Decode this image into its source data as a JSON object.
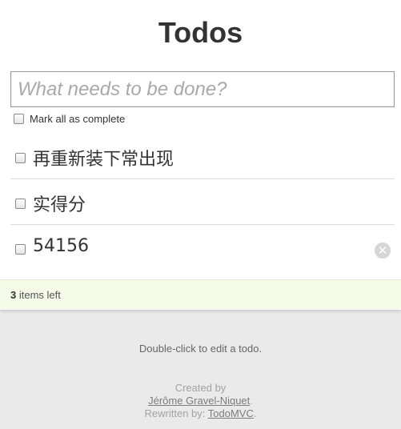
{
  "header": {
    "title": "Todos"
  },
  "new_todo": {
    "placeholder": "What needs to be done?"
  },
  "toggle_all": {
    "label": "Mark all as complete"
  },
  "todos": [
    {
      "text": "再重新装下常出现",
      "completed": false
    },
    {
      "text": "实得分",
      "completed": false
    },
    {
      "text": "54156",
      "completed": false
    }
  ],
  "destroy_icon": "close-icon",
  "footer": {
    "count": "3",
    "count_suffix": " items left"
  },
  "info": {
    "instructions": "Double-click to edit a todo.",
    "created_by": "Created by",
    "author_link": "Jérôme Gravel-Niquet",
    "author_period": ".",
    "rewritten_by": "Rewritten by: ",
    "rewriter_link": "TodoMVC",
    "rewriter_period": "."
  },
  "colors": {
    "footer_bg": "#f5fae9",
    "page_bg": "#eaeaea",
    "app_bg": "#ffffff"
  }
}
